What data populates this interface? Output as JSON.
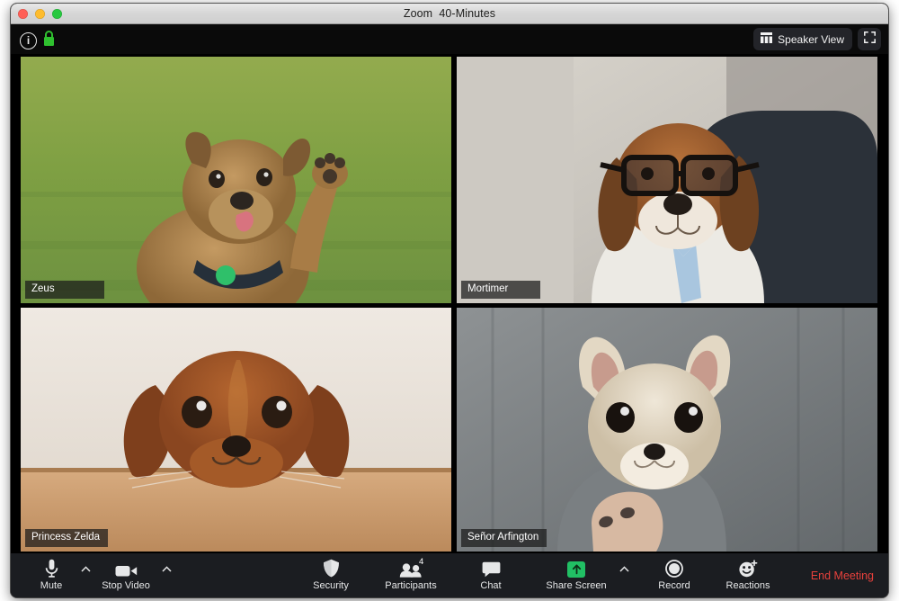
{
  "window": {
    "title": "Zoom  40-Minutes",
    "traffic_lights": [
      "close",
      "minimize",
      "maximize"
    ]
  },
  "topbar": {
    "info_icon": "info-icon",
    "info_glyph": "i",
    "lock_icon": "green-lock-icon",
    "lock_color": "#2fc02f",
    "view_button": {
      "label": "Speaker View",
      "icon": "grid-view-icon"
    },
    "fullscreen_button": {
      "label": "",
      "icon": "fullscreen-icon"
    }
  },
  "grid": {
    "active_speaker_color": "#e7f08a",
    "tiles": [
      {
        "name": "Zeus",
        "position": "top-left",
        "active_speaker": true,
        "scene": "scruffy terrier on grass raising paw"
      },
      {
        "name": "Mortimer",
        "position": "top-right",
        "active_speaker": false,
        "scene": "beagle wearing glasses shirt and tie in office chair"
      },
      {
        "name": "Princess Zelda",
        "position": "bottom-left",
        "active_speaker": false,
        "scene": "cavalier spaniel resting chin on wooden table"
      },
      {
        "name": "Señor Arfington",
        "position": "bottom-right",
        "active_speaker": false,
        "scene": "chihuahua held in person's arms wearing grey sweater"
      }
    ]
  },
  "toolbar": {
    "items": [
      {
        "label": "Mute",
        "icon": "microphone-icon",
        "caret": true
      },
      {
        "label": "Stop Video",
        "icon": "video-camera-icon",
        "caret": true
      },
      {
        "label": "Security",
        "icon": "shield-icon",
        "caret": false
      },
      {
        "label": "Participants",
        "icon": "participants-icon",
        "caret": false,
        "badge": "4"
      },
      {
        "label": "Chat",
        "icon": "chat-bubble-icon",
        "caret": false
      },
      {
        "label": "Share Screen",
        "icon": "share-screen-icon",
        "caret": true
      },
      {
        "label": "Record",
        "icon": "record-circle-icon",
        "caret": false
      },
      {
        "label": "Reactions",
        "icon": "reactions-smiley-icon",
        "caret": false
      }
    ],
    "end_meeting": {
      "label": "End Meeting",
      "color": "#e8413c"
    }
  }
}
